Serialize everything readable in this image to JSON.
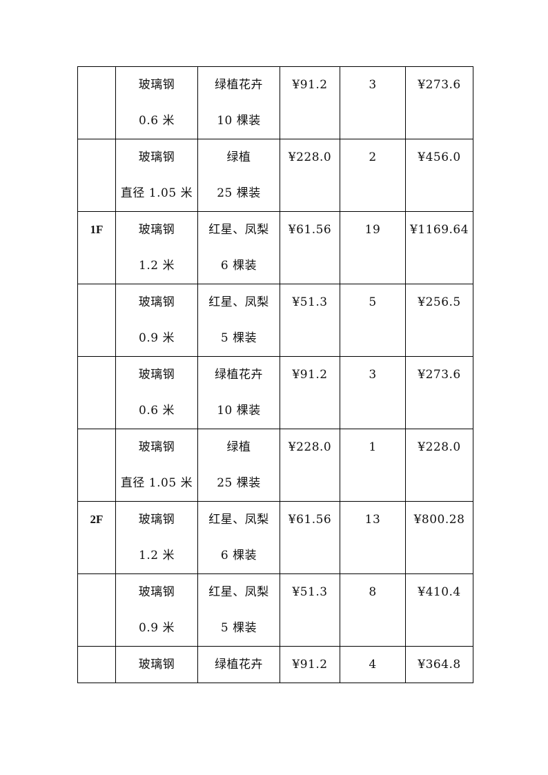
{
  "table": {
    "rows": [
      {
        "floor": "",
        "material": [
          "玻璃钢",
          "0.6 米"
        ],
        "plants": [
          "绿植花卉",
          "10 棵装"
        ],
        "unit_price": "¥91.2",
        "quantity": "3",
        "total": "¥273.6"
      },
      {
        "floor": "",
        "material": [
          "玻璃钢",
          "直径 1.05 米"
        ],
        "plants": [
          "绿植",
          "25 棵装"
        ],
        "unit_price": "¥228.0",
        "quantity": "2",
        "total": "¥456.0"
      },
      {
        "floor": "1F",
        "material": [
          "玻璃钢",
          "1.2 米"
        ],
        "plants": [
          "红星、凤梨",
          "6 棵装"
        ],
        "unit_price": "¥61.56",
        "quantity": "19",
        "total": "¥1169.64"
      },
      {
        "floor": "",
        "material": [
          "玻璃钢",
          "0.9 米"
        ],
        "plants": [
          "红星、凤梨",
          "5 棵装"
        ],
        "unit_price": "¥51.3",
        "quantity": "5",
        "total": "¥256.5"
      },
      {
        "floor": "",
        "material": [
          "玻璃钢",
          "0.6 米"
        ],
        "plants": [
          "绿植花卉",
          "10 棵装"
        ],
        "unit_price": "¥91.2",
        "quantity": "3",
        "total": "¥273.6"
      },
      {
        "floor": "",
        "material": [
          "玻璃钢",
          "直径 1.05 米"
        ],
        "plants": [
          "绿植",
          "25 棵装"
        ],
        "unit_price": "¥228.0",
        "quantity": "1",
        "total": "¥228.0"
      },
      {
        "floor": "2F",
        "material": [
          "玻璃钢",
          "1.2 米"
        ],
        "plants": [
          "红星、凤梨",
          "6 棵装"
        ],
        "unit_price": "¥61.56",
        "quantity": "13",
        "total": "¥800.28"
      },
      {
        "floor": "",
        "material": [
          "玻璃钢",
          "0.9 米"
        ],
        "plants": [
          "红星、凤梨",
          "5 棵装"
        ],
        "unit_price": "¥51.3",
        "quantity": "8",
        "total": "¥410.4"
      },
      {
        "floor": "",
        "material": [
          "玻璃钢"
        ],
        "plants": [
          "绿植花卉"
        ],
        "unit_price": "¥91.2",
        "quantity": "4",
        "total": "¥364.8"
      }
    ]
  }
}
